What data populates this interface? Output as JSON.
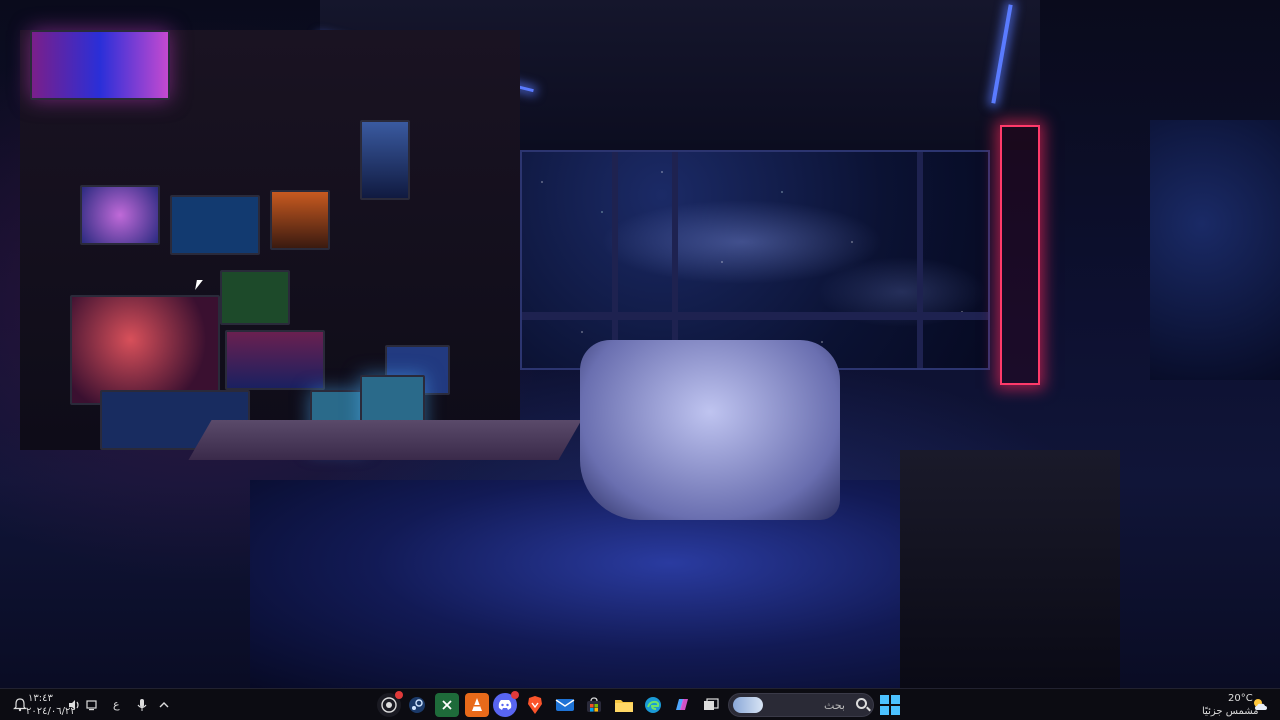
{
  "desktop": {
    "wallpaper": "cyberpunk-bedroom-wallpaper"
  },
  "taskbar": {
    "search": {
      "placeholder": "بحث"
    },
    "apps": [
      {
        "name": "start-menu",
        "icon": "windows-logo-icon"
      },
      {
        "name": "task-view",
        "icon": "task-view-icon"
      },
      {
        "name": "copilot",
        "icon": "copilot-icon"
      },
      {
        "name": "edge",
        "icon": "edge-browser-icon"
      },
      {
        "name": "file-explorer",
        "icon": "folder-icon"
      },
      {
        "name": "microsoft-store",
        "icon": "store-icon"
      },
      {
        "name": "outlook",
        "icon": "mail-icon"
      },
      {
        "name": "brave",
        "icon": "brave-browser-icon"
      },
      {
        "name": "discord",
        "icon": "discord-icon"
      },
      {
        "name": "vlc",
        "icon": "vlc-cone-icon"
      },
      {
        "name": "excel",
        "icon": "excel-icon"
      },
      {
        "name": "steam",
        "icon": "steam-icon"
      },
      {
        "name": "recorder",
        "icon": "record-icon"
      }
    ],
    "weather": {
      "temp": "20°C",
      "condition": "مشمس جزئيًا"
    },
    "clock": {
      "time": "١٣:٤٣",
      "date": "٢٠٢٤/٠٦/٢٢"
    },
    "language": "ع",
    "colors": {
      "accent": "#4cc2ff",
      "taskbar_bg": "#0c0c12"
    }
  }
}
